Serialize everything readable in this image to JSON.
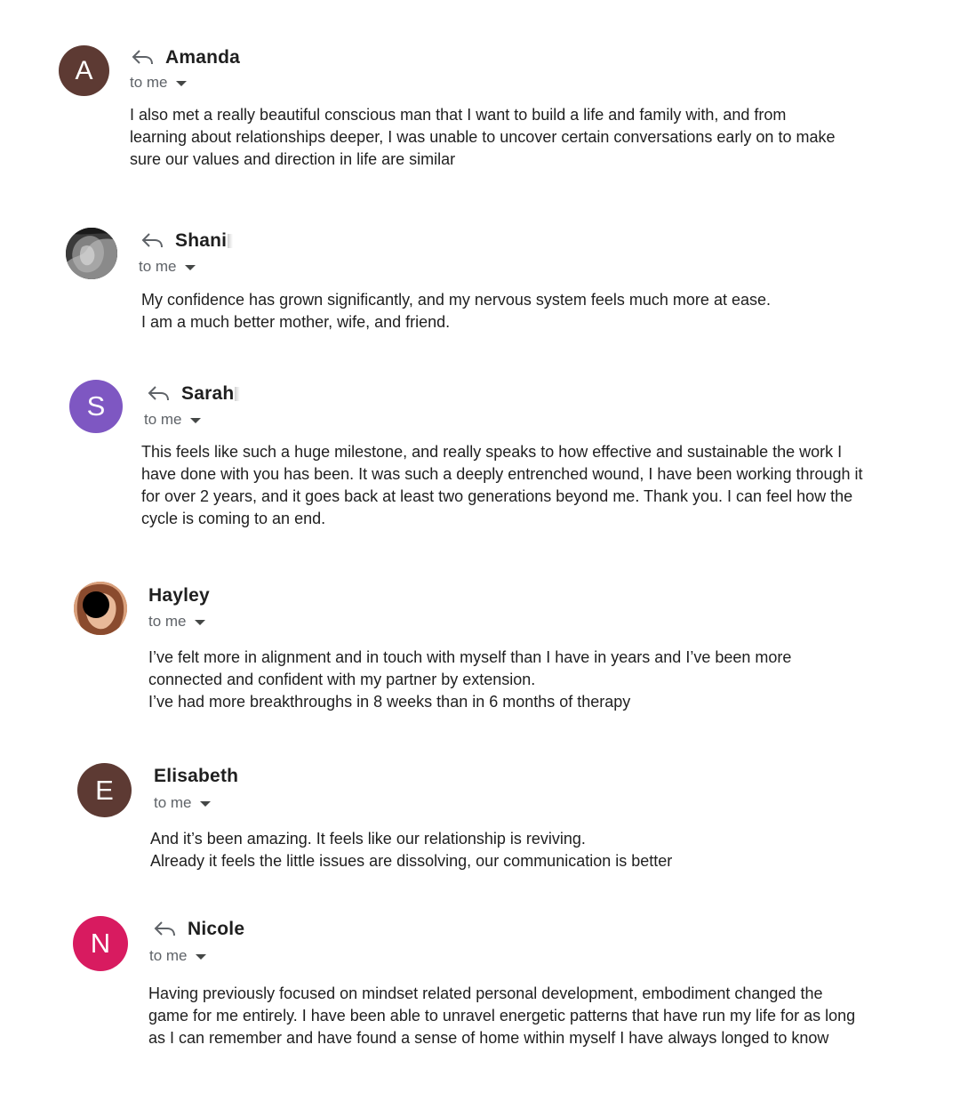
{
  "messages": [
    {
      "sender": "Amanda",
      "avatar_letter": "A",
      "avatar_color": "#5d3a33",
      "recipient": "to me",
      "show_reply_icon": true,
      "body": "I also met a really beautiful conscious man that I want to build a life and family with, and from\nlearning about relationships deeper, I was unable to uncover certain conversations early on to make\nsure our values and direction in life are similar"
    },
    {
      "sender": "Shani",
      "avatar_letter": "",
      "avatar_icon": "profile-photo",
      "recipient": "to me",
      "show_reply_icon": true,
      "body": "My confidence has grown significantly, and my nervous system feels much more at ease.\nI am a much better mother, wife, and friend."
    },
    {
      "sender": "Sarah",
      "avatar_letter": "S",
      "avatar_color": "#7e57c2",
      "recipient": "to me",
      "show_reply_icon": true,
      "body": "This feels like such a huge milestone, and really speaks to how effective and sustainable the work I\nhave done with you has been. It was such a deeply entrenched wound, I have been working through it\nfor over 2 years, and it goes back at least two generations beyond me. Thank you. I can feel how the\ncycle is coming to an end."
    },
    {
      "sender": "Hayley",
      "avatar_letter": "",
      "avatar_icon": "profile-photo",
      "recipient": "to me",
      "show_reply_icon": false,
      "body": "I’ve felt more in alignment and in touch with myself than I have in years and I’ve been more\nconnected and confident with my partner by extension.\nI’ve had more breakthroughs in 8 weeks than in 6 months of therapy"
    },
    {
      "sender": "Elisabeth",
      "avatar_letter": "E",
      "avatar_color": "#5d3a33",
      "recipient": "to me",
      "show_reply_icon": false,
      "body": "And it’s been amazing. It feels like our relationship is reviving.\nAlready it feels the little issues are dissolving, our communication is better"
    },
    {
      "sender": "Nicole",
      "avatar_letter": "N",
      "avatar_color": "#d81b60",
      "recipient": "to me",
      "show_reply_icon": true,
      "body": "Having previously focused on mindset related personal development, embodiment changed the\ngame for me entirely. I have been able to unravel energetic patterns that have run my life for as long\nas I can remember and have found a sense of home within myself I have always longed to know"
    }
  ],
  "icons": {
    "reply": "reply-arrow-icon",
    "caret": "chevron-down-icon"
  }
}
